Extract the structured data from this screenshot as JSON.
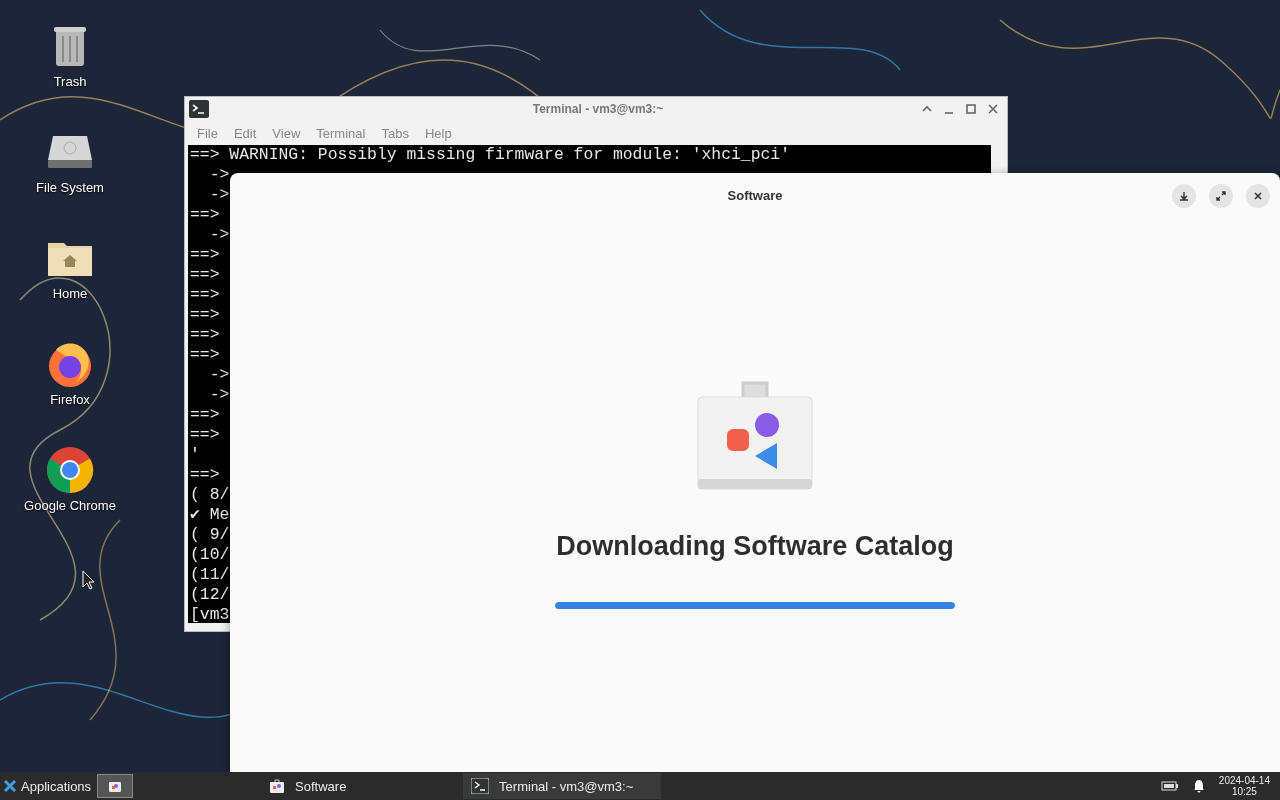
{
  "desktop_icons": [
    {
      "label": "Trash",
      "kind": "trash"
    },
    {
      "label": "File System",
      "kind": "drive"
    },
    {
      "label": "Home",
      "kind": "home"
    },
    {
      "label": "Firefox",
      "kind": "firefox"
    },
    {
      "label": "Google Chrome",
      "kind": "chrome"
    }
  ],
  "terminal": {
    "title": "Terminal - vm3@vm3:~",
    "menu": [
      "File",
      "Edit",
      "View",
      "Terminal",
      "Tabs",
      "Help"
    ],
    "lines": [
      "==> WARNING: Possibly missing firmware for module: 'xhci_pci'",
      "  ->",
      "  ->",
      "==>",
      "  ->",
      "==>",
      "==>",
      "==>",
      "==>",
      "==>",
      "==>",
      "  ->",
      "  ->",
      "==>",
      "==>",
      "'",
      "==>",
      "( 8/",
      "✔ Me",
      "( 9/",
      "(10/",
      "(11/",
      "(12/",
      "[vm3"
    ]
  },
  "software": {
    "title": "Software",
    "heading": "Downloading Software Catalog",
    "progress": {
      "level": 1
    }
  },
  "taskbar": {
    "menu_label": "Applications",
    "tasks": [
      {
        "label": "Software",
        "kind": "software",
        "selected": false
      },
      {
        "label": "Terminal - vm3@vm3:~",
        "kind": "terminal",
        "selected": true
      }
    ],
    "date": "2024-04-14",
    "time": "10:25"
  }
}
